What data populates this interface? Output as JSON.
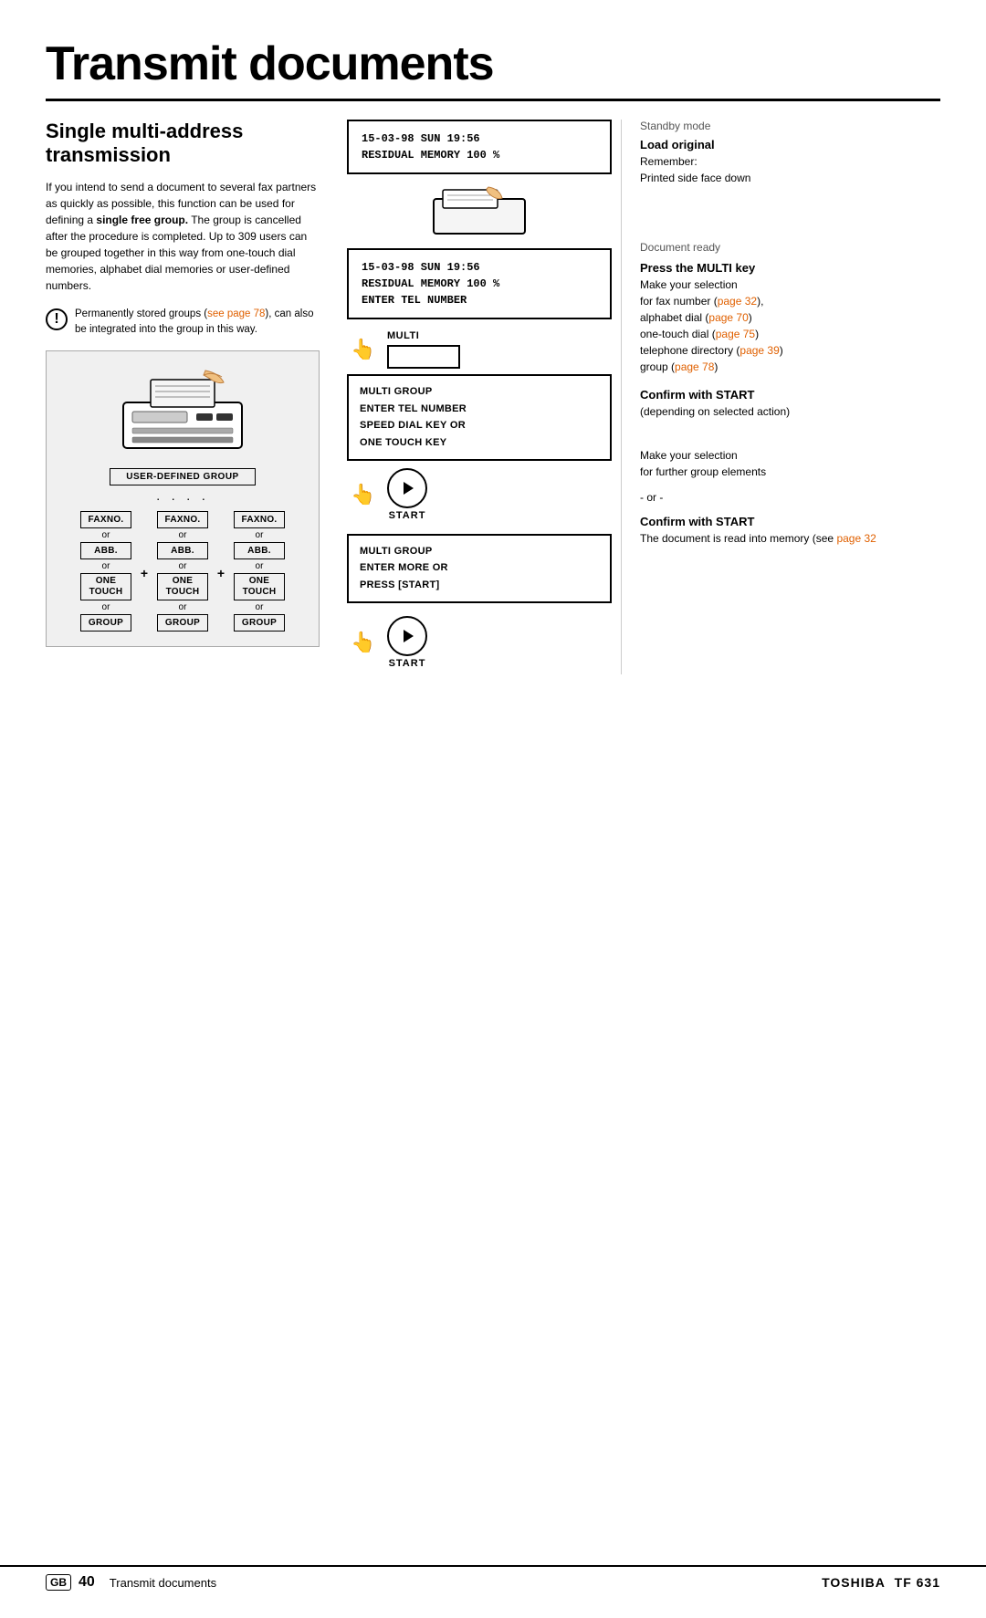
{
  "page": {
    "title": "Transmit documents",
    "footer": {
      "gb_label": "GB",
      "page_number": "40",
      "section": "Transmit documents",
      "brand": "TOSHIBA",
      "model": "TF 631"
    }
  },
  "section": {
    "title_line1": "Single  multi-address",
    "title_line2": "transmission",
    "body_text": "If you intend to send a document to several fax partners as quickly as possible, this function can be used for defining a",
    "body_bold": "single free group.",
    "body_text2": " The group is cancelled after the procedure is completed. Up to 309 users can be grouped together in this way from one-touch dial memories, alphabet dial memories or user-defined numbers.",
    "warning_text": "Permanently stored groups (see page 78), can also be integrated into the group in this way.",
    "warning_link_text": "see page 78"
  },
  "diagram": {
    "user_defined_group": "USER-DEFINED GROUP",
    "col1": {
      "btn1": "FAXNO.",
      "or1": "or",
      "btn2": "ABB.",
      "or2": "or",
      "btn3_line1": "ONE",
      "btn3_line2": "TOUCH",
      "or3": "or",
      "btn4": "GROUP"
    },
    "col2": {
      "btn1": "FAXNO.",
      "or1": "or",
      "btn2": "ABB.",
      "or2": "or",
      "btn3_line1": "ONE",
      "btn3_line2": "TOUCH",
      "or3": "or",
      "btn4": "GROUP"
    },
    "col3": {
      "btn1": "FAXNO.",
      "or1": "or",
      "btn2": "ABB.",
      "or2": "or",
      "btn3_line1": "ONE",
      "btn3_line2": "TOUCH",
      "or3": "or",
      "btn4": "GROUP"
    }
  },
  "steps": {
    "display1": {
      "line1": "15-03-98   SUN   19:56",
      "line2": "RESIDUAL MEMORY 100 %"
    },
    "display2": {
      "line1": "15-03-98   SUN   19:56",
      "line2": "RESIDUAL MEMORY 100 %",
      "line3": "ENTER TEL NUMBER"
    },
    "multi_label": "MULTI",
    "menu_box1": {
      "line1": "MULTI GROUP",
      "line2": "ENTER TEL NUMBER",
      "line3": "SPEED DIAL KEY OR",
      "line4": "ONE TOUCH KEY"
    },
    "start_label": "START",
    "menu_box2": {
      "line1": "MULTI GROUP",
      "line2": "",
      "line3": "ENTER MORE OR",
      "line4": "PRESS [START]"
    },
    "start_label2": "START"
  },
  "right_col": {
    "standby": "Standby mode",
    "load_original": {
      "title": "Load original",
      "desc1": "Remember:",
      "desc2": "Printed side face down"
    },
    "document_ready": "Document ready",
    "press_multi": {
      "title": "Press the MULTI key",
      "desc1": "Make your selection",
      "desc2": "for fax number (page 32),",
      "desc2_link": "page 32",
      "desc3": "alphabet dial (page 70)",
      "desc3_link": "page 70",
      "desc4": "one-touch dial (page 75)",
      "desc4_link": "page 75",
      "desc5": "telephone directory (page 39)",
      "desc5_link": "page 39",
      "desc6": "group (page 78)",
      "desc6_link": "page 78"
    },
    "confirm_start1": {
      "title": "Confirm with START",
      "desc": "(depending on selected action)"
    },
    "make_selection": {
      "desc1": "Make your selection",
      "desc2": "for further group elements",
      "or_divider": "- or -"
    },
    "confirm_start2": {
      "title": "Confirm with START",
      "desc1": "The document is read into memory (see",
      "desc2": "page 32)",
      "desc_link": "page 32"
    }
  }
}
